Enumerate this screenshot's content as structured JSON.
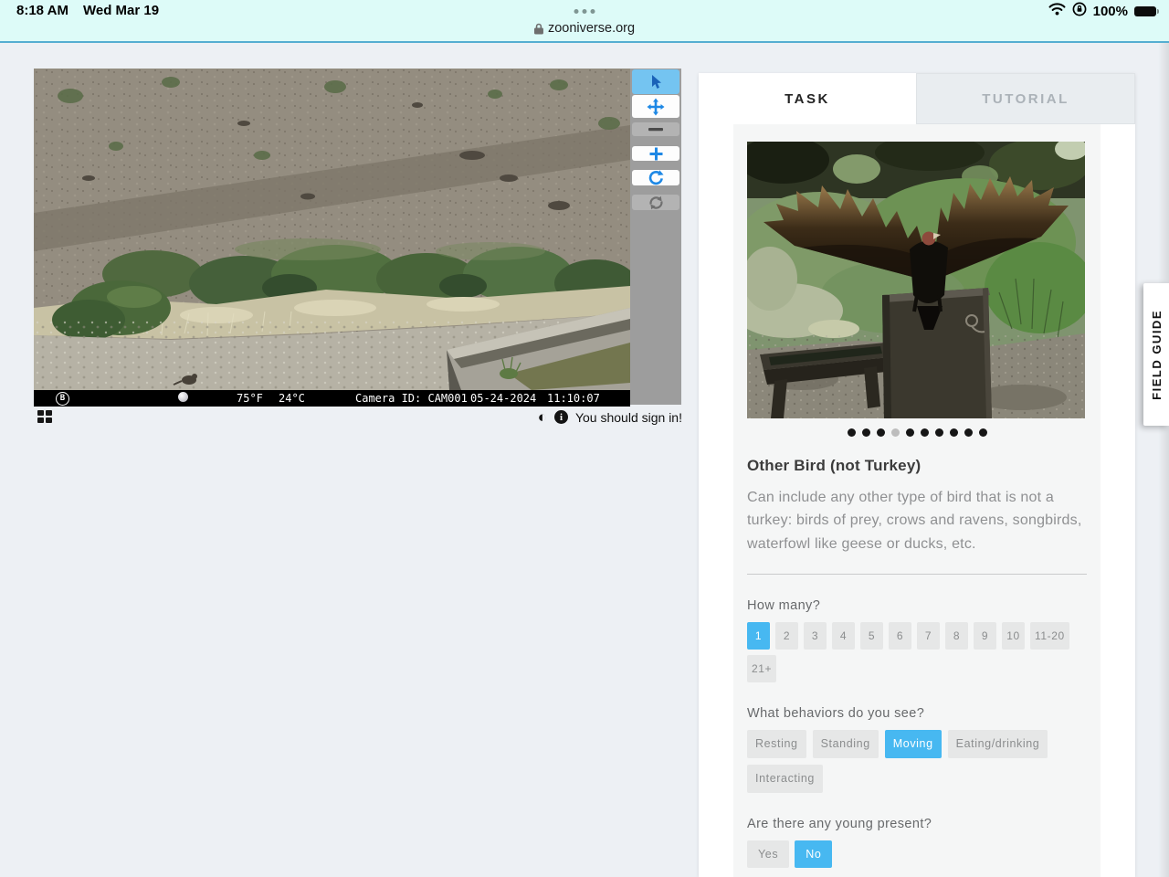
{
  "colors": {
    "accent": "#47b8f1",
    "toolbar_selected": "#74c4f1",
    "chrome_background": "#ddfbf8",
    "chrome_line": "#55aed1",
    "page_background": "#edf0f4"
  },
  "status_bar": {
    "time": "8:18 AM",
    "date": "Wed Mar 19",
    "battery_percent": "100%",
    "icons": [
      "wifi-icon",
      "rotation-lock-icon",
      "battery-icon"
    ]
  },
  "browser": {
    "url": "zooniverse.org",
    "icons": [
      "lock-icon",
      "menu-dots-icon"
    ]
  },
  "viewer": {
    "osd": {
      "logo": "B",
      "temp_f": "75°F",
      "temp_c": "24°C",
      "camera_id": "Camera ID: CAM001",
      "date": "05-24-2024",
      "time": "11:10:07"
    },
    "toolbar_icons": [
      "select-tool-icon",
      "pan-tool-icon",
      "zoom-out-icon",
      "zoom-in-icon",
      "rotate-icon",
      "reset-icon"
    ],
    "footer_icons": [
      "grid-icon",
      "contrast-icon",
      "info-icon"
    ],
    "signin_message": "You should sign in!"
  },
  "task_panel": {
    "tabs": [
      {
        "label": "TASK",
        "active": true
      },
      {
        "label": "TUTORIAL",
        "active": false
      }
    ],
    "carousel": {
      "count": 10,
      "active_index": 3
    },
    "heading": "Other Bird (not Turkey)",
    "description": "Can include any other type of bird that is not a turkey: birds of prey, crows and ravens, songbirds, waterfowl like geese or ducks, etc.",
    "questions": [
      {
        "label": "How many?",
        "kind": "count",
        "options": [
          "1",
          "2",
          "3",
          "4",
          "5",
          "6",
          "7",
          "8",
          "9",
          "10",
          "11-20",
          "21+"
        ],
        "selected": "1"
      },
      {
        "label": "What behaviors do you see?",
        "kind": "chip",
        "options": [
          "Resting",
          "Standing",
          "Moving",
          "Eating/drinking",
          "Interacting"
        ],
        "selected": "Moving"
      },
      {
        "label": "Are there any young present?",
        "kind": "yesno",
        "options": [
          "Yes",
          "No"
        ],
        "selected": "No"
      }
    ]
  },
  "field_guide": {
    "label": "FIELD GUIDE"
  }
}
